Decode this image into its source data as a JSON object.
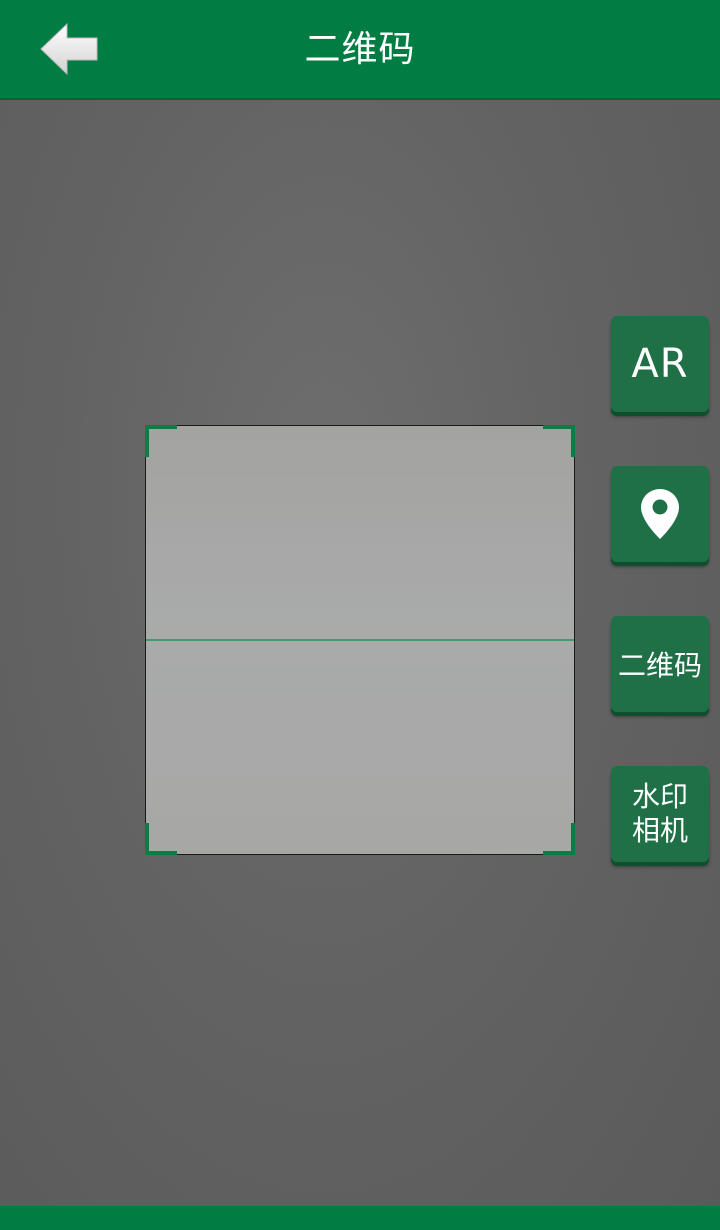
{
  "header": {
    "title": "二维码",
    "back_icon": "back-arrow-icon"
  },
  "scanner": {
    "frame_color": "#0c7d47",
    "line_color": "#3f9a70"
  },
  "side_buttons": {
    "ar": {
      "label": "AR"
    },
    "location": {
      "icon": "location-pin-icon"
    },
    "qrcode": {
      "label": "二维码"
    },
    "watermark": {
      "label": "水印\n相机"
    }
  },
  "colors": {
    "brand_green": "#017c42",
    "button_green": "#1f7047"
  }
}
